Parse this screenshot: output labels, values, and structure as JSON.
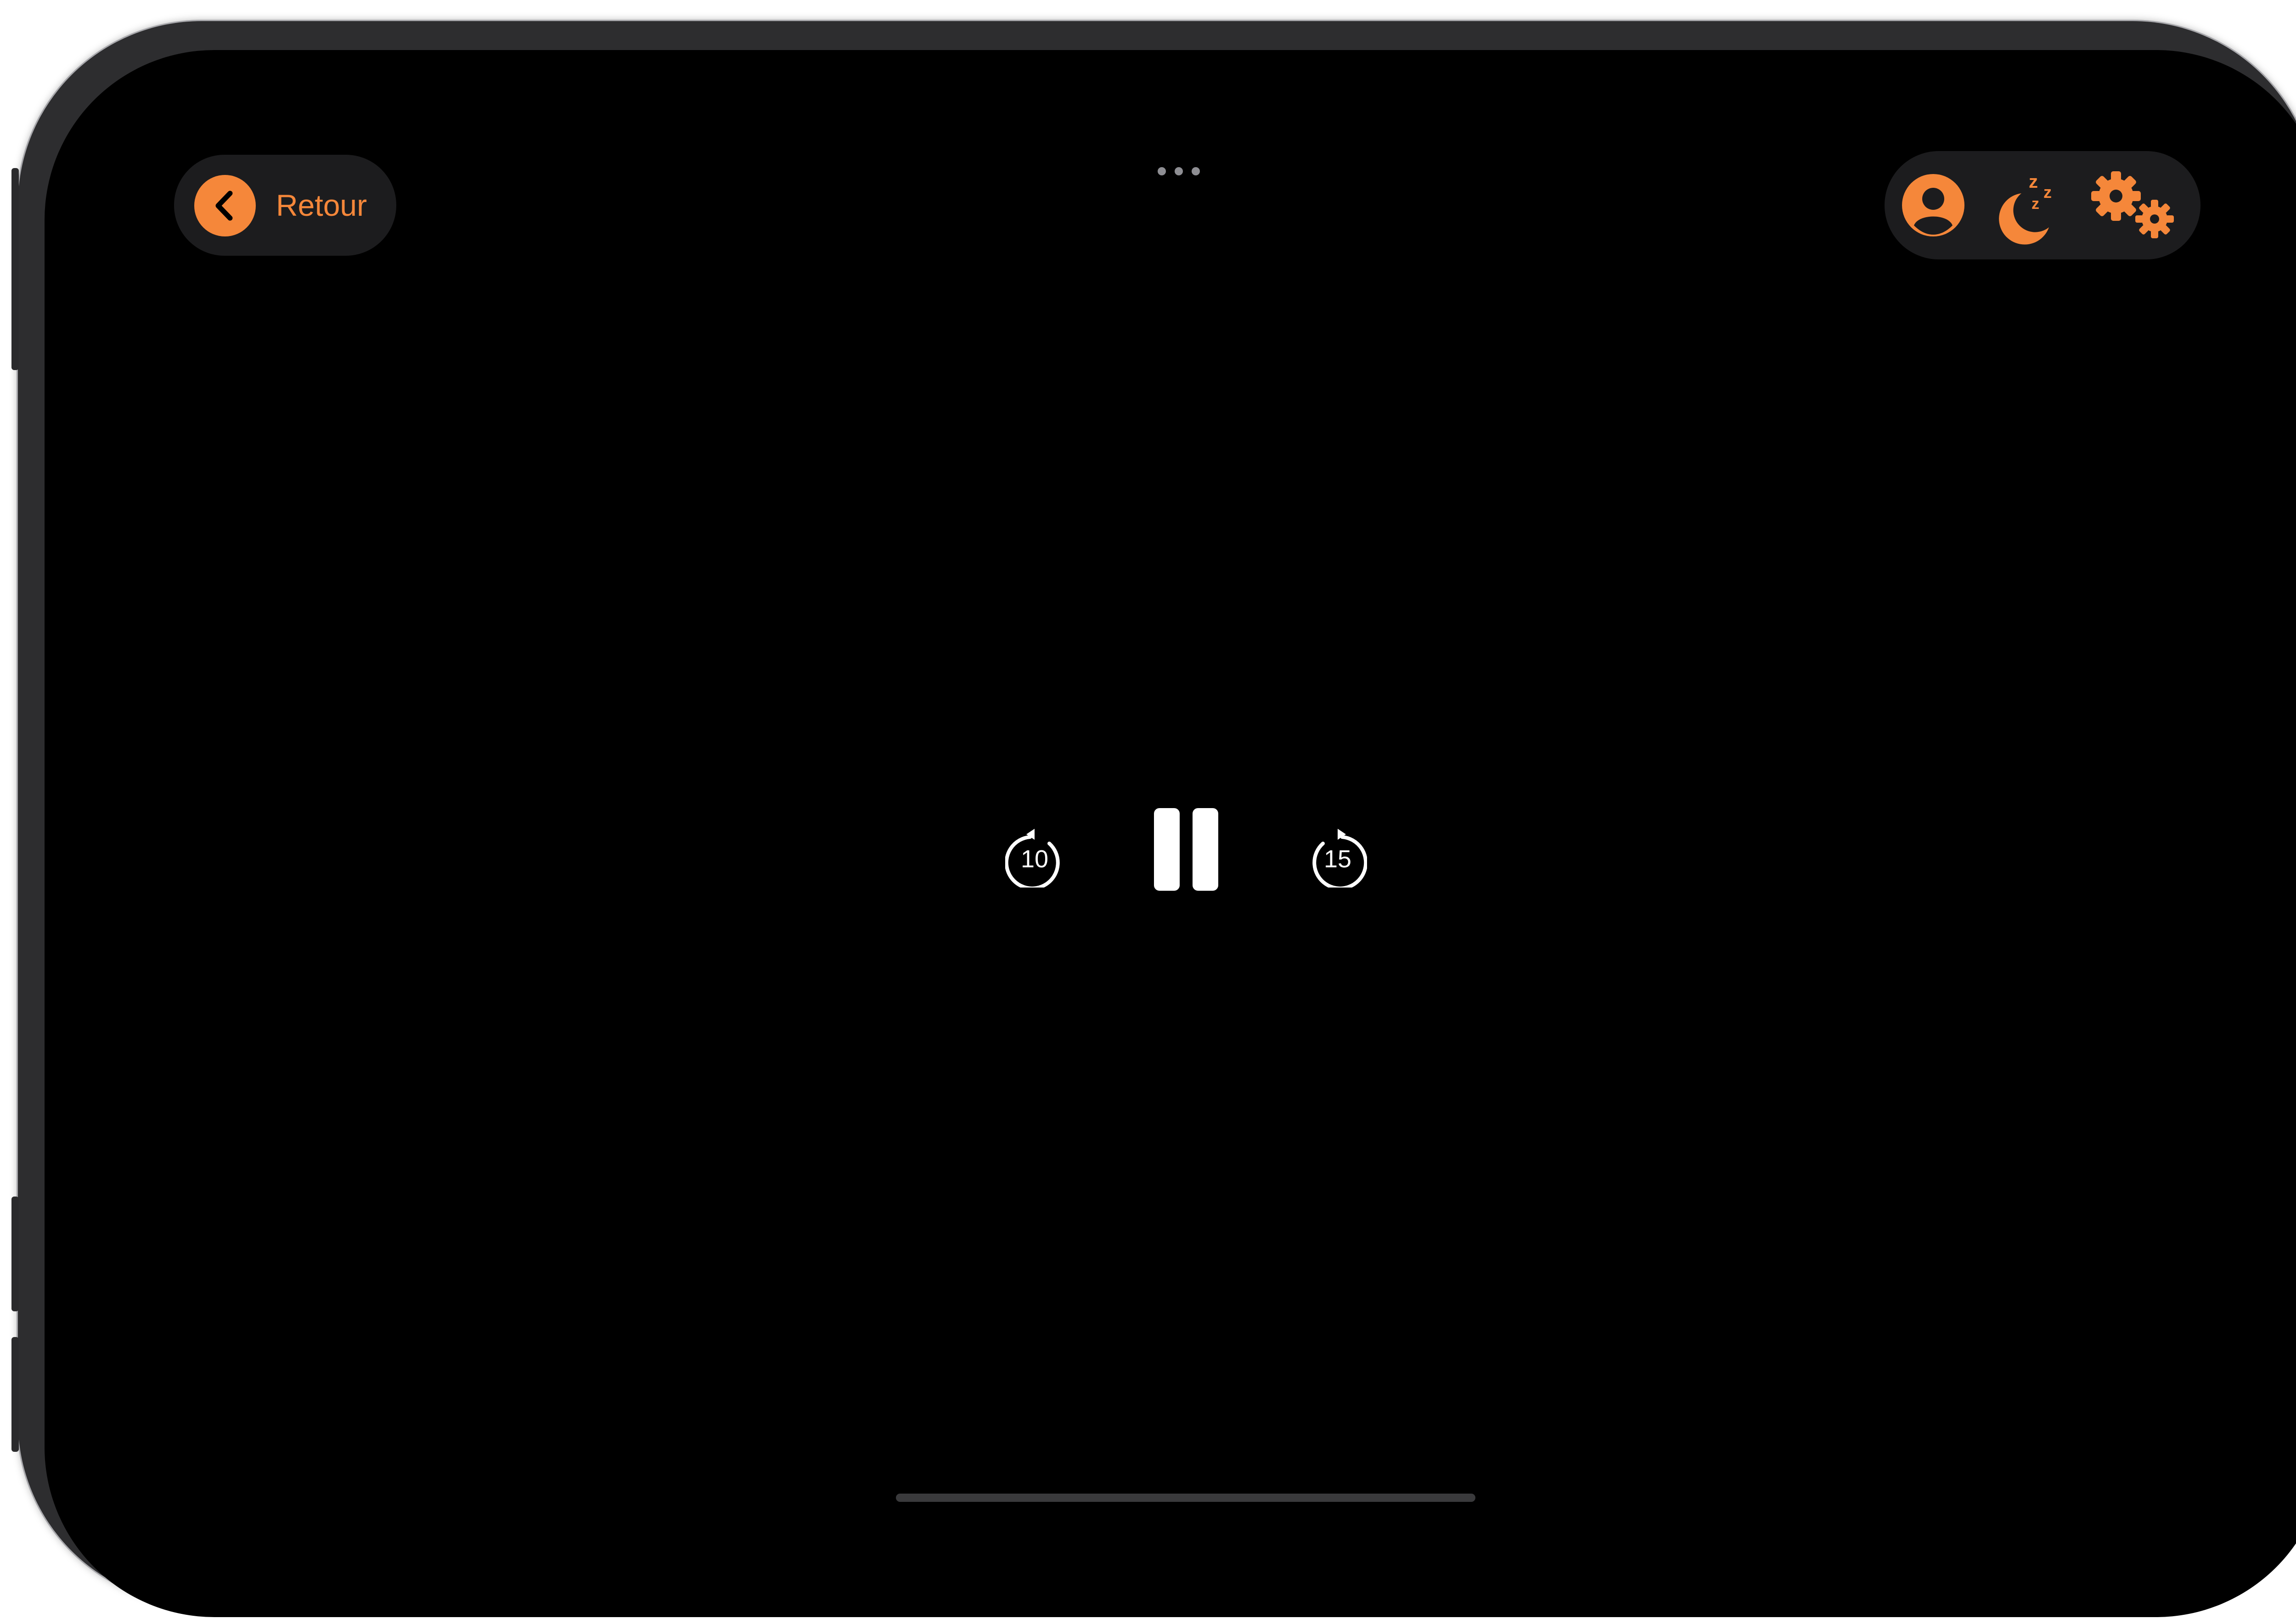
{
  "header": {
    "back_label": "Retour",
    "more_icon": "ellipsis-icon",
    "actions": [
      {
        "name": "profile",
        "icon": "person-circle-icon"
      },
      {
        "name": "sleep-timer",
        "icon": "moon-zzz-icon"
      },
      {
        "name": "settings",
        "icon": "gears-icon"
      }
    ]
  },
  "player": {
    "skip_back_label": "10",
    "skip_forward_label": "15",
    "state": "playing",
    "pause_icon": "pause-icon"
  },
  "colors": {
    "accent": "#f5873a",
    "background": "#000000",
    "pill": "#1c1c1e",
    "controls": "#ffffff"
  }
}
